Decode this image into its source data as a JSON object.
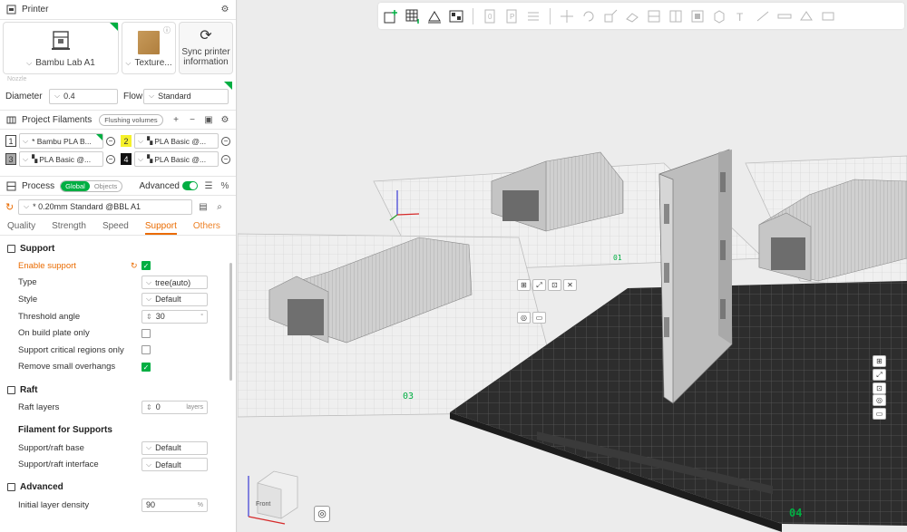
{
  "printer": {
    "title": "Printer",
    "printer_name": "Bambu Lab A1",
    "plate_name": "Texture...",
    "sync_label_1": "Sync printer",
    "sync_label_2": "information",
    "nozzle_label": "Nozzle",
    "diameter_label": "Diameter",
    "diameter_value": "0.4",
    "flow_label": "Flow",
    "flow_value": "Standard"
  },
  "filaments": {
    "title": "Project Filaments",
    "flushing_label": "Flushing volumes",
    "items": [
      {
        "num": "1",
        "name": "* Bambu PLA B...",
        "color": "#ffffff",
        "text_color": "#333333"
      },
      {
        "num": "2",
        "name": "PLA Basic @...",
        "color": "#f6f12a",
        "text_color": "#333333"
      },
      {
        "num": "3",
        "name": "PLA Basic @...",
        "color": "#a9a9a9",
        "text_color": "#333333"
      },
      {
        "num": "4",
        "name": "PLA Basic @...",
        "color": "#111111",
        "text_color": "#ffffff"
      }
    ]
  },
  "process": {
    "title": "Process",
    "global_label": "Global",
    "objects_label": "Objects",
    "advanced_label": "Advanced",
    "preset": "* 0.20mm Standard @BBL A1",
    "tabs": [
      "Quality",
      "Strength",
      "Speed",
      "Support",
      "Others"
    ],
    "active_tab": "Support"
  },
  "support": {
    "group_title": "Support",
    "enable_label": "Enable support",
    "type_label": "Type",
    "type_value": "tree(auto)",
    "style_label": "Style",
    "style_value": "Default",
    "threshold_label": "Threshold angle",
    "threshold_value": "30",
    "threshold_unit": "°",
    "build_plate_label": "On build plate only",
    "critical_label": "Support critical regions only",
    "overhangs_label": "Remove small overhangs"
  },
  "raft": {
    "group_title": "Raft",
    "layers_label": "Raft layers",
    "layers_value": "0",
    "layers_unit": "layers"
  },
  "filament_support": {
    "group_title": "Filament for Supports",
    "base_label": "Support/raft base",
    "base_value": "Default",
    "interface_label": "Support/raft interface",
    "interface_value": "Default"
  },
  "advanced": {
    "group_title": "Advanced",
    "density_label": "Initial layer density",
    "density_value": "90",
    "density_unit": "%"
  },
  "viewport": {
    "plate_labels": [
      "01",
      "03",
      "04"
    ],
    "cube_front": "Front",
    "colors": {
      "accent": "#00ae42",
      "orange": "#ea6b00",
      "bed": "#2d2d2d"
    }
  }
}
